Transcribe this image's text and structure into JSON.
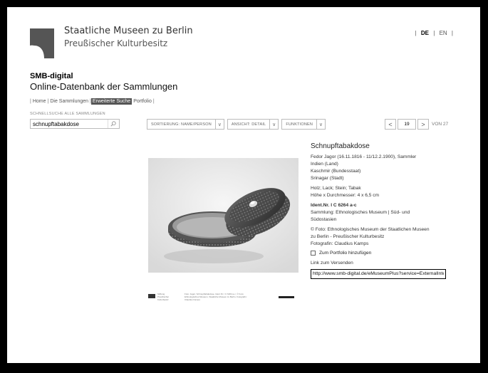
{
  "header": {
    "brand_line1": "Staatliche Museen zu Berlin",
    "brand_line2": "Preußischer Kulturbesitz",
    "lang_sep_left": "|",
    "lang_de": "DE",
    "lang_sep_mid": "|",
    "lang_en": "EN",
    "lang_sep_right": "|"
  },
  "site": {
    "title": "SMB-digital",
    "subtitle": "Online-Datenbank der Sammlungen"
  },
  "nav": {
    "sep": "|",
    "home": "Home",
    "collections": "Die Sammlungen",
    "advanced": "Erweiterte Suche",
    "portfolio": "Portfolio"
  },
  "quicksearch": {
    "label": "SCHNELLSUCHE ALLE SAMMLUNGEN",
    "value": "schnupftabakdose"
  },
  "toolbar": {
    "sort": "SORTIERUNG: NAME/PERSON",
    "view": "ANSICHT: DETAIL",
    "functions": "FUNKTIONEN",
    "chevron": "∨"
  },
  "pager": {
    "prev": "<",
    "current": "19",
    "next": ">",
    "total": "VON 27"
  },
  "caption": {
    "logo_text": "Stiftung Preußischer Kulturbesitz",
    "text": "Foto: Jagor, Schnupftabakdose, Ident.Nr. I C 6264 a-c, © Foto: Ethnologisches Museum, Staatliche Museen zu Berlin, Fotografin: Claudius Kamps"
  },
  "object": {
    "title": "Schnupftabakdose",
    "lines_a": [
      "Fedor Jagor (16.11.1816 - 11/12.2.1900), Sammler",
      "Indien (Land)",
      "Kaschmir (Bundesstaat)",
      "Srinagar (Stadt)"
    ],
    "lines_b": [
      "Holz; Lack; Stein; Tabak",
      "Höhe x Durchmesser: 4 x 6,5 cm"
    ],
    "ident": "Ident.Nr. I C 6264 a-c",
    "lines_c": [
      "Sammlung: Ethnologisches Museum | Süd- und",
      "Südostasien"
    ],
    "lines_d": [
      "© Foto: Ethnologisches Museum der Staatlichen Museen",
      "zu Berlin - Preußischer Kulturbesitz",
      "Fotografin: Claudius Kamps"
    ],
    "portfolio_label": "Zum Portfolio hinzufügen",
    "link_label": "Link zum Versenden",
    "link_value": "http://www.smb-digital.de/eMuseumPlus?service=ExternalInterface"
  },
  "colors": {
    "nav_active_bg": "#555555"
  }
}
